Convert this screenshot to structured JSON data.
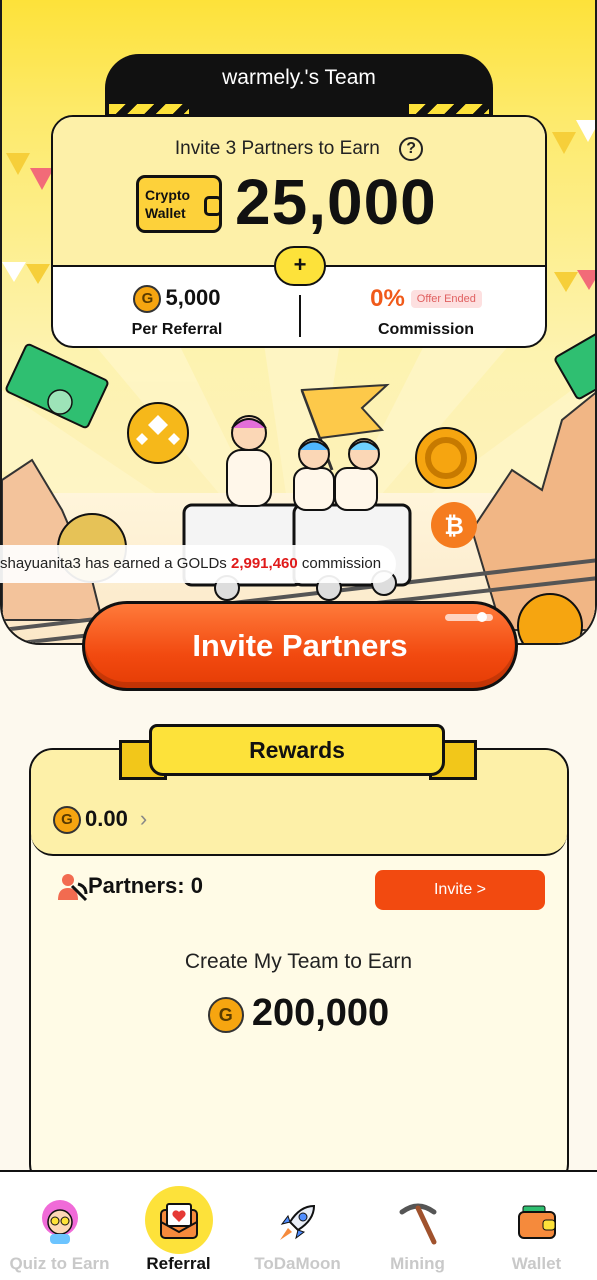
{
  "team": {
    "title": "warmely.'s Team"
  },
  "earn_card": {
    "invite_text": "Invite 3 Partners to Earn",
    "help_icon": "?",
    "wallet_badge_line1": "Crypto",
    "wallet_badge_line2": "Wallet",
    "amount": "25,000",
    "plus": "+",
    "per_referral_value": "5,000",
    "per_referral_label": "Per Referral",
    "commission_value": "0%",
    "commission_badge": "Offer Ended",
    "commission_label": "Commission"
  },
  "ticker": {
    "prefix": "shayuanita3 has earned a GOLDs ",
    "amount": "2,991,460",
    "suffix": " commission"
  },
  "invite_button": {
    "label": "Invite Partners"
  },
  "rewards": {
    "title": "Rewards",
    "balance": "0.00",
    "partners_label": "Partners: 0",
    "invite_label": "Invite >",
    "create_team_text": "Create My Team to Earn",
    "create_team_amount": "200,000"
  },
  "nav": [
    {
      "label": "Quiz to Earn",
      "icon": "quiz-avatar-icon"
    },
    {
      "label": "Referral",
      "icon": "envelope-heart-icon"
    },
    {
      "label": "ToDaMoon",
      "icon": "rocket-icon"
    },
    {
      "label": "Mining",
      "icon": "pickaxe-icon"
    },
    {
      "label": "Wallet",
      "icon": "wallet-icon"
    }
  ],
  "colors": {
    "brand_yellow": "#fde23a",
    "accent_orange": "#f24a10",
    "ticker_red": "#e01a1a"
  }
}
